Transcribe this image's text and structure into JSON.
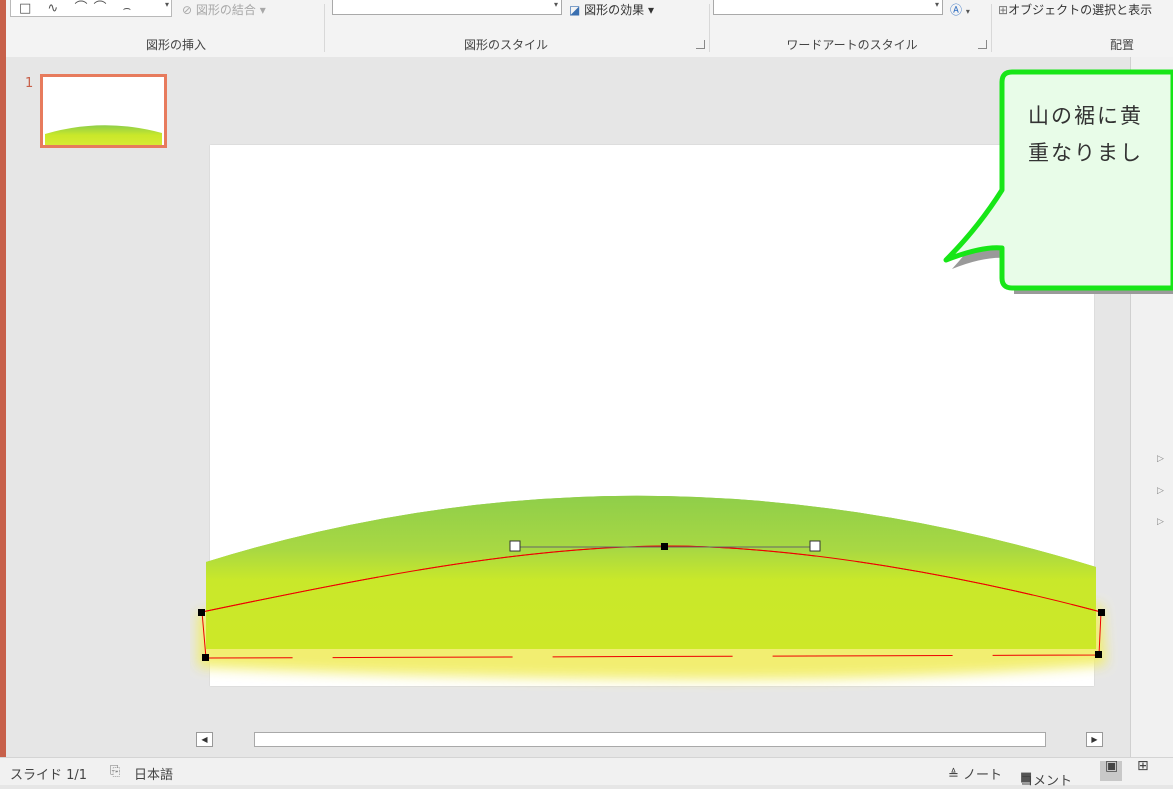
{
  "ribbon": {
    "merge_shapes": "図形の結合 ▾",
    "shape_effects": "図形の効果 ▾",
    "selection_pane": "オブジェクトの選択と表示",
    "groups": [
      "図形の挿入",
      "図形のスタイル",
      "ワードアートのスタイル",
      "配置"
    ]
  },
  "thumbnails": {
    "slide_number": "1"
  },
  "callout": {
    "line1": "山の裾に黄",
    "line2": "重なりまし",
    "fill": "#e8fce8",
    "border": "#17e617"
  },
  "status": {
    "slide_indicator": "スライド 1/1",
    "language": "日本語",
    "notes": "≜ ノート",
    "comments": "コメント"
  },
  "colors": {
    "mountain_green": "#8fce4a",
    "mountain_yellow": "#c9e82a",
    "glow_yellow": "#f2ee6a",
    "accent": "#c7604a"
  }
}
